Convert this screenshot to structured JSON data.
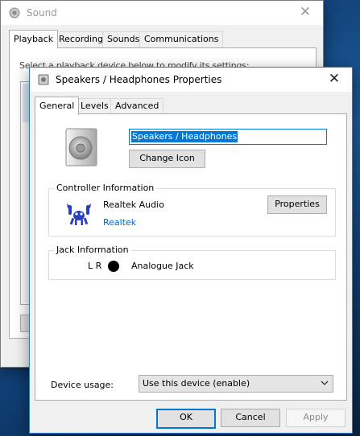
{
  "sound_window": {
    "title": "Sound",
    "tabs": [
      {
        "label": "Playback"
      },
      {
        "label": "Recording"
      },
      {
        "label": "Sounds"
      },
      {
        "label": "Communications"
      }
    ],
    "instruction": "Select a playback device below to modify its settings:"
  },
  "props_window": {
    "title": "Speakers / Headphones Properties",
    "tabs": [
      {
        "label": "General"
      },
      {
        "label": "Levels"
      },
      {
        "label": "Advanced"
      }
    ],
    "device_name": "Speakers / Headphones",
    "change_icon_label": "Change Icon",
    "controller": {
      "group_label": "Controller Information",
      "name": "Realtek Audio",
      "vendor_link": "Realtek",
      "properties_label": "Properties"
    },
    "jack": {
      "group_label": "Jack Information",
      "channels": "L R",
      "description": "Analogue Jack",
      "jack_color": "#000000"
    },
    "device_usage": {
      "label": "Device usage:",
      "selected": "Use this device (enable)"
    },
    "buttons": {
      "ok": "OK",
      "cancel": "Cancel",
      "apply": "Apply"
    }
  }
}
